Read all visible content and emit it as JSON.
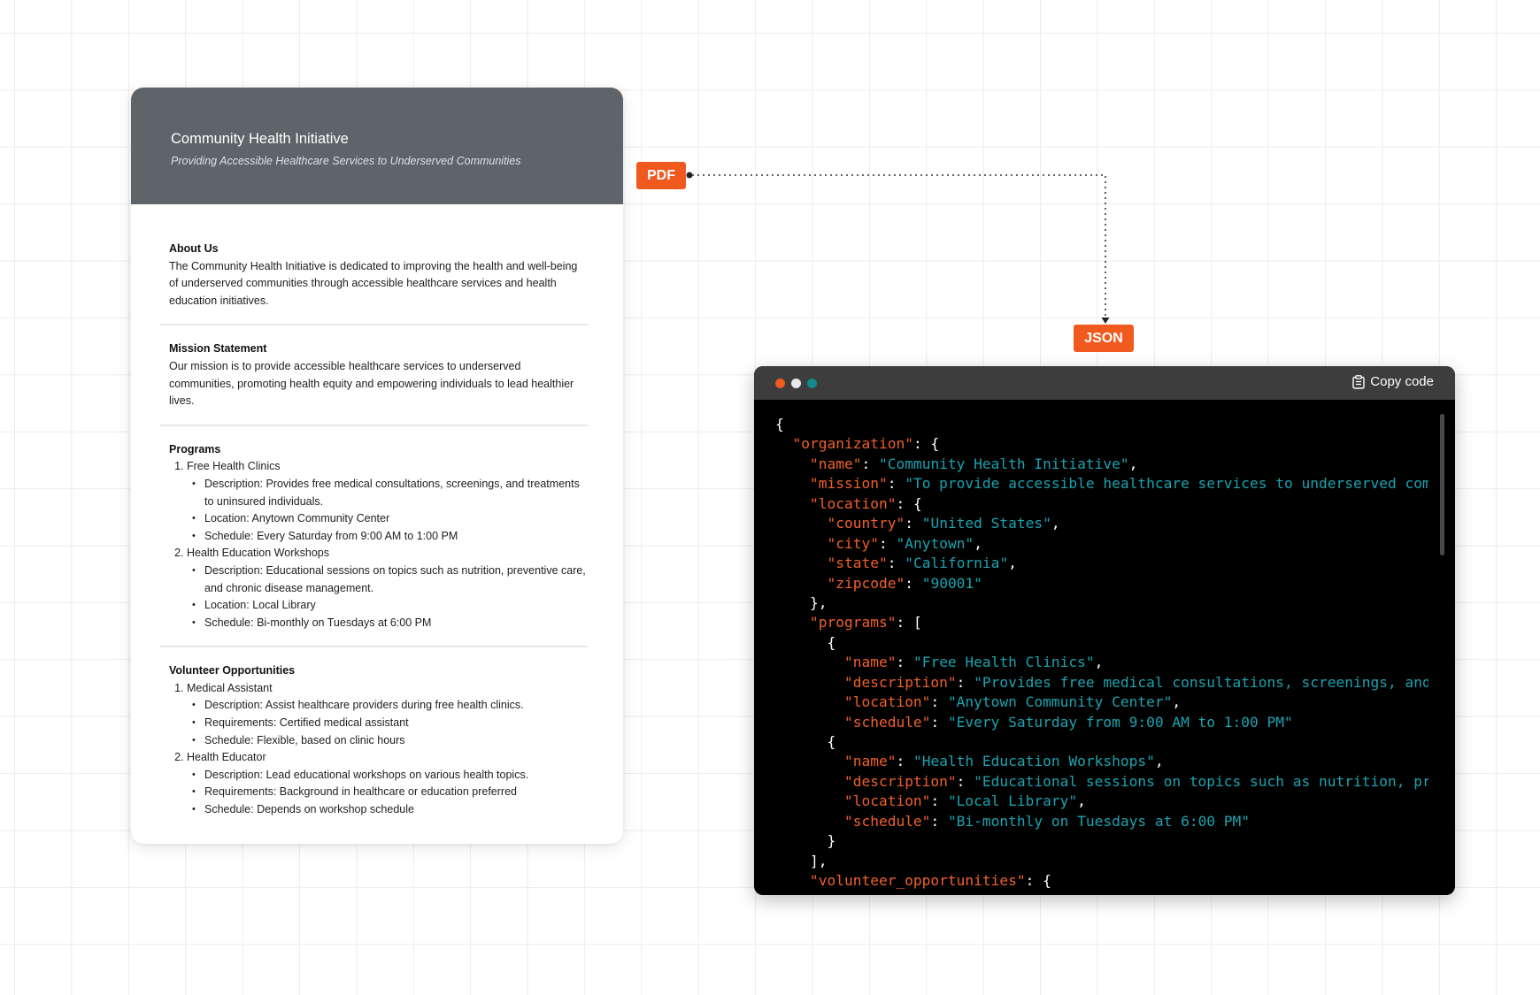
{
  "document": {
    "title": "Community Health Initiative",
    "subtitle": "Providing Accessible Healthcare Services to Underserved Communities",
    "about": {
      "heading": "About Us",
      "text": "The Community Health Initiative is dedicated to improving the health and well-being of underserved communities through accessible healthcare services and health education initiatives."
    },
    "mission": {
      "heading": "Mission Statement",
      "text": "Our mission is to provide accessible healthcare services to underserved communities, promoting health equity and empowering individuals to lead healthier lives."
    },
    "programs": {
      "heading": "Programs",
      "items": [
        {
          "name": "Free Health Clinics",
          "details": [
            "Description: Provides free medical consultations, screenings, and treatments to uninsured individuals.",
            "Location: Anytown Community Center",
            "Schedule: Every Saturday from 9:00 AM to 1:00 PM"
          ]
        },
        {
          "name": "Health Education Workshops",
          "details": [
            "Description: Educational sessions on topics such as nutrition, preventive care, and chronic disease management.",
            "Location: Local Library",
            "Schedule: Bi-monthly on Tuesdays at 6:00 PM"
          ]
        }
      ]
    },
    "volunteer": {
      "heading": "Volunteer Opportunities",
      "items": [
        {
          "name": "Medical Assistant",
          "details": [
            "Description: Assist healthcare providers during free health clinics.",
            "Requirements: Certified medical assistant",
            "Schedule: Flexible, based on clinic hours"
          ]
        },
        {
          "name": "Health Educator",
          "details": [
            "Description: Lead educational workshops on various health topics.",
            "Requirements: Background in healthcare or education preferred",
            "Schedule: Depends on workshop schedule"
          ]
        }
      ]
    }
  },
  "tags": {
    "pdf": "PDF",
    "json": "JSON"
  },
  "colors": {
    "accent": "#f05a1f",
    "header": "#5f6468",
    "code_key": "#f0602b",
    "code_string": "#1ba3b0",
    "dot_teal": "#158a8a"
  },
  "code_window": {
    "copy_label": "Copy code",
    "copy_icon": "clipboard-icon",
    "lines": [
      [
        {
          "t": "p",
          "v": "{"
        }
      ],
      [
        {
          "t": "p",
          "v": "  "
        },
        {
          "t": "k",
          "v": "\"organization\""
        },
        {
          "t": "p",
          "v": ": {"
        }
      ],
      [
        {
          "t": "p",
          "v": "    "
        },
        {
          "t": "k",
          "v": "\"name\""
        },
        {
          "t": "p",
          "v": ": "
        },
        {
          "t": "s",
          "v": "\"Community Health Initiative\""
        },
        {
          "t": "p",
          "v": ","
        }
      ],
      [
        {
          "t": "p",
          "v": "    "
        },
        {
          "t": "k",
          "v": "\"mission\""
        },
        {
          "t": "p",
          "v": ": "
        },
        {
          "t": "s",
          "v": "\"To provide accessible healthcare services to underserved communities, promoting health equity\""
        },
        {
          "t": "p",
          "v": ","
        }
      ],
      [
        {
          "t": "p",
          "v": "    "
        },
        {
          "t": "k",
          "v": "\"location\""
        },
        {
          "t": "p",
          "v": ": {"
        }
      ],
      [
        {
          "t": "p",
          "v": "      "
        },
        {
          "t": "k",
          "v": "\"country\""
        },
        {
          "t": "p",
          "v": ": "
        },
        {
          "t": "s",
          "v": "\"United States\""
        },
        {
          "t": "p",
          "v": ","
        }
      ],
      [
        {
          "t": "p",
          "v": "      "
        },
        {
          "t": "k",
          "v": "\"city\""
        },
        {
          "t": "p",
          "v": ": "
        },
        {
          "t": "s",
          "v": "\"Anytown\""
        },
        {
          "t": "p",
          "v": ","
        }
      ],
      [
        {
          "t": "p",
          "v": "      "
        },
        {
          "t": "k",
          "v": "\"state\""
        },
        {
          "t": "p",
          "v": ": "
        },
        {
          "t": "s",
          "v": "\"California\""
        },
        {
          "t": "p",
          "v": ","
        }
      ],
      [
        {
          "t": "p",
          "v": "      "
        },
        {
          "t": "k",
          "v": "\"zipcode\""
        },
        {
          "t": "p",
          "v": ": "
        },
        {
          "t": "s",
          "v": "\"90001\""
        }
      ],
      [
        {
          "t": "p",
          "v": "    },"
        }
      ],
      [
        {
          "t": "p",
          "v": "    "
        },
        {
          "t": "k",
          "v": "\"programs\""
        },
        {
          "t": "p",
          "v": ": ["
        }
      ],
      [
        {
          "t": "p",
          "v": "      {"
        }
      ],
      [
        {
          "t": "p",
          "v": "        "
        },
        {
          "t": "k",
          "v": "\"name\""
        },
        {
          "t": "p",
          "v": ": "
        },
        {
          "t": "s",
          "v": "\"Free Health Clinics\""
        },
        {
          "t": "p",
          "v": ","
        }
      ],
      [
        {
          "t": "p",
          "v": "        "
        },
        {
          "t": "k",
          "v": "\"description\""
        },
        {
          "t": "p",
          "v": ": "
        },
        {
          "t": "s",
          "v": "\"Provides free medical consultations, screenings, and treatments\""
        },
        {
          "t": "p",
          "v": ","
        }
      ],
      [
        {
          "t": "p",
          "v": "        "
        },
        {
          "t": "k",
          "v": "\"location\""
        },
        {
          "t": "p",
          "v": ": "
        },
        {
          "t": "s",
          "v": "\"Anytown Community Center\""
        },
        {
          "t": "p",
          "v": ","
        }
      ],
      [
        {
          "t": "p",
          "v": "        "
        },
        {
          "t": "k",
          "v": "\"schedule\""
        },
        {
          "t": "p",
          "v": ": "
        },
        {
          "t": "s",
          "v": "\"Every Saturday from 9:00 AM to 1:00 PM\""
        }
      ],
      [
        {
          "t": "p",
          "v": "      {"
        }
      ],
      [
        {
          "t": "p",
          "v": "        "
        },
        {
          "t": "k",
          "v": "\"name\""
        },
        {
          "t": "p",
          "v": ": "
        },
        {
          "t": "s",
          "v": "\"Health Education Workshops\""
        },
        {
          "t": "p",
          "v": ","
        }
      ],
      [
        {
          "t": "p",
          "v": "        "
        },
        {
          "t": "k",
          "v": "\"description\""
        },
        {
          "t": "p",
          "v": ": "
        },
        {
          "t": "s",
          "v": "\"Educational sessions on topics such as nutrition, preventive care\""
        },
        {
          "t": "p",
          "v": ","
        }
      ],
      [
        {
          "t": "p",
          "v": "        "
        },
        {
          "t": "k",
          "v": "\"location\""
        },
        {
          "t": "p",
          "v": ": "
        },
        {
          "t": "s",
          "v": "\"Local Library\""
        },
        {
          "t": "p",
          "v": ","
        }
      ],
      [
        {
          "t": "p",
          "v": "        "
        },
        {
          "t": "k",
          "v": "\"schedule\""
        },
        {
          "t": "p",
          "v": ": "
        },
        {
          "t": "s",
          "v": "\"Bi-monthly on Tuesdays at 6:00 PM\""
        }
      ],
      [
        {
          "t": "p",
          "v": "      }"
        }
      ],
      [
        {
          "t": "p",
          "v": "    ],"
        }
      ],
      [
        {
          "t": "p",
          "v": "    "
        },
        {
          "t": "k",
          "v": "\"volunteer_opportunities\""
        },
        {
          "t": "p",
          "v": ": {"
        }
      ]
    ]
  }
}
